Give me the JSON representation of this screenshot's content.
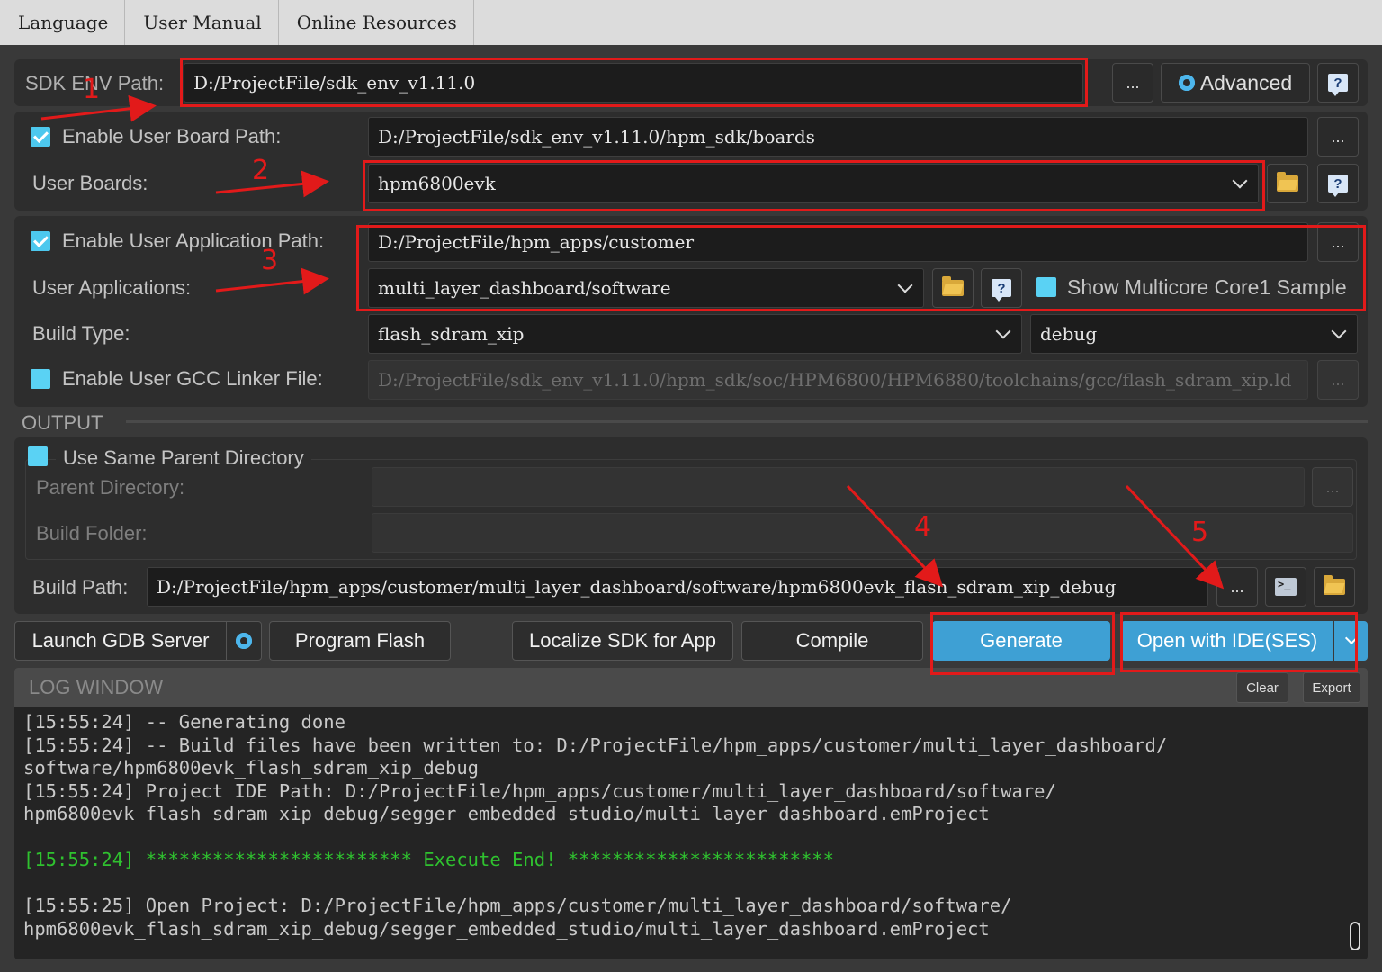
{
  "menu": {
    "language": "Language",
    "manual": "User Manual",
    "online": "Online Resources"
  },
  "sdk": {
    "label": "SDK ENV Path:",
    "path": "D:/ProjectFile/sdk_env_v1.11.0",
    "browse": "...",
    "advanced": "Advanced",
    "help": "?"
  },
  "board": {
    "enable_label": "Enable User Board Path:",
    "path": "D:/ProjectFile/sdk_env_v1.11.0/hpm_sdk/boards",
    "boards_label": "User Boards:",
    "selected_board": "hpm6800evk",
    "browse": "..."
  },
  "app": {
    "enable_label": "Enable User Application Path:",
    "path": "D:/ProjectFile/hpm_apps/customer",
    "apps_label": "User Applications:",
    "selected_app": "multi_layer_dashboard/software",
    "multicore_label": "Show Multicore Core1 Sample",
    "build_type_label": "Build Type:",
    "build_type": "flash_sdram_xip",
    "build_config": "debug",
    "linker_label": "Enable User GCC Linker File:",
    "linker_path": "D:/ProjectFile/sdk_env_v1.11.0/hpm_sdk/soc/HPM6800/HPM6880/toolchains/gcc/flash_sdram_xip.ld",
    "browse": "..."
  },
  "output": {
    "section_title": "OUTPUT",
    "same_parent_label": "Use Same Parent Directory",
    "parent_dir_label": "Parent Directory:",
    "build_folder_label": "Build Folder:",
    "build_path_label": "Build Path:",
    "build_path": "D:/ProjectFile/hpm_apps/customer/multi_layer_dashboard/software/hpm6800evk_flash_sdram_xip_debug",
    "browse": "..."
  },
  "actions": {
    "launch_gdb": "Launch GDB Server",
    "program_flash": "Program Flash",
    "localize": "Localize SDK for App",
    "compile": "Compile",
    "generate": "Generate",
    "open_ide": "Open with IDE(SES)"
  },
  "log": {
    "title": "LOG WINDOW",
    "clear": "Clear",
    "export": "Export",
    "lines": [
      "[15:55:24] -- Generating done",
      "[15:55:24] -- Build files have been written to: D:/ProjectFile/hpm_apps/customer/multi_layer_dashboard/",
      "software/hpm6800evk_flash_sdram_xip_debug",
      "[15:55:24] Project IDE Path: D:/ProjectFile/hpm_apps/customer/multi_layer_dashboard/software/",
      "hpm6800evk_flash_sdram_xip_debug/segger_embedded_studio/multi_layer_dashboard.emProject",
      "",
      "[15:55:24] ************************ Execute End! ************************",
      "",
      "[15:55:25] Open Project: D:/ProjectFile/hpm_apps/customer/multi_layer_dashboard/software/",
      "hpm6800evk_flash_sdram_xip_debug/segger_embedded_studio/multi_layer_dashboard.emProject"
    ]
  },
  "annotations": {
    "n1": "1",
    "n2": "2",
    "n3": "3",
    "n4": "4",
    "n5": "5"
  },
  "colors": {
    "accent": "#3ea0d4",
    "annotation": "#e21a1a",
    "log_green": "#2fc22f"
  }
}
